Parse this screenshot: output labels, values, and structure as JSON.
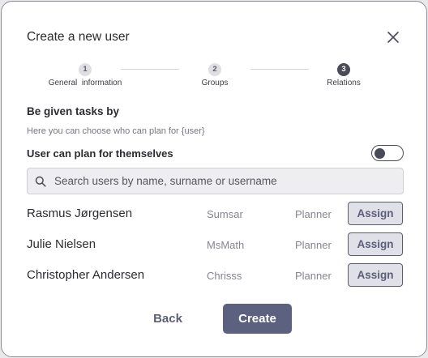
{
  "dialog": {
    "title": "Create a new user"
  },
  "steps": [
    {
      "number": "1",
      "label": "General  information",
      "active": false
    },
    {
      "number": "2",
      "label": "Groups",
      "active": false
    },
    {
      "number": "3",
      "label": "Relations",
      "active": true
    }
  ],
  "section": {
    "title": "Be given tasks by",
    "subtitle": "Here you can choose who can plan for {user}",
    "self_plan_label": "User can plan for themselves",
    "self_plan_enabled": false
  },
  "search": {
    "placeholder": "Search users by name, surname or username",
    "value": ""
  },
  "users": [
    {
      "name": "Rasmus Jørgensen",
      "username": "Sumsar",
      "role": "Planner",
      "action": "Assign"
    },
    {
      "name": "Julie Nielsen",
      "username": "MsMath",
      "role": "Planner",
      "action": "Assign"
    },
    {
      "name": "Christopher Andersen",
      "username": "Chrisss",
      "role": "Planner",
      "action": "Assign"
    }
  ],
  "footer": {
    "back_label": "Back",
    "create_label": "Create"
  },
  "icons": {
    "close": "close-icon",
    "search": "search-icon"
  },
  "colors": {
    "primary": "#5d6180",
    "step_active": "#4a4b58",
    "assign_bg": "#dfe0e8"
  }
}
